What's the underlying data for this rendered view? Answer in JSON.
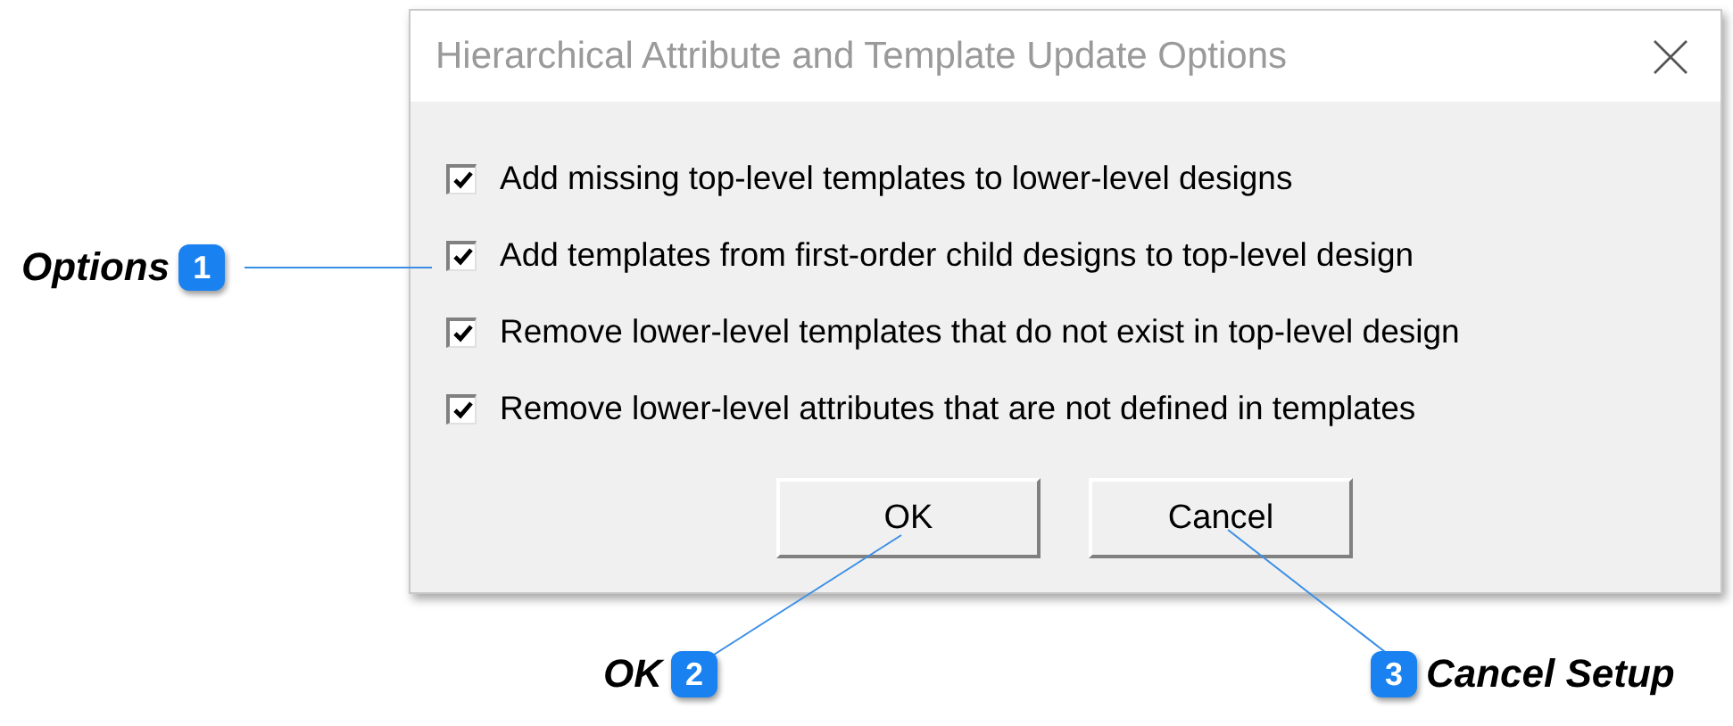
{
  "dialog": {
    "title": "Hierarchical Attribute and Template Update Options",
    "options": [
      {
        "label": "Add missing top-level templates to lower-level designs",
        "checked": true
      },
      {
        "label": "Add templates from first-order child designs to top-level design",
        "checked": true
      },
      {
        "label": "Remove lower-level templates that do not exist in top-level design",
        "checked": true
      },
      {
        "label": "Remove lower-level attributes that are not defined in templates",
        "checked": true
      }
    ],
    "buttons": [
      "OK",
      "Cancel"
    ]
  },
  "callouts": [
    {
      "number": "1",
      "label": "Options",
      "kind": "left"
    },
    {
      "number": "2",
      "label": "OK",
      "kind": "left"
    },
    {
      "number": "3",
      "label": "Cancel Setup",
      "kind": "right"
    }
  ]
}
